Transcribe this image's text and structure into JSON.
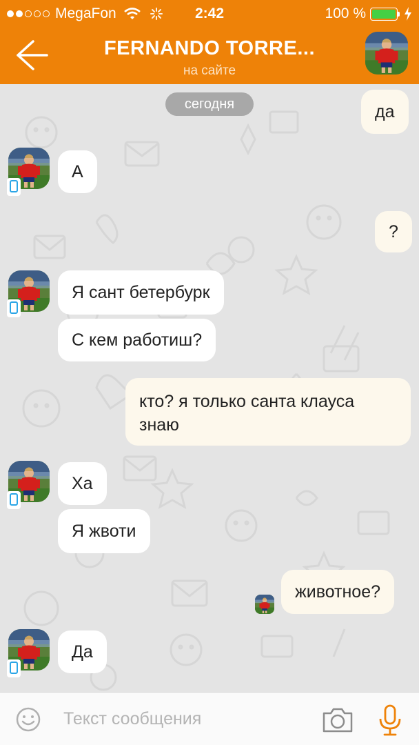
{
  "status_bar": {
    "carrier": "MegaFon",
    "time": "2:42",
    "battery": "100 %"
  },
  "header": {
    "title": "FERNANDO TORRE...",
    "subtitle": "на сайте"
  },
  "chat": {
    "date_label": "сегодня",
    "messages": [
      {
        "direction": "out",
        "text": "да"
      },
      {
        "direction": "in",
        "text": "А"
      },
      {
        "direction": "out",
        "text": "?"
      },
      {
        "direction": "in",
        "text": "Я сант бетербурк"
      },
      {
        "direction": "in",
        "text": "С кем работиш?"
      },
      {
        "direction": "out",
        "text": "кто? я только санта клауса знаю"
      },
      {
        "direction": "in",
        "text": "Ха"
      },
      {
        "direction": "in",
        "text": "Я жвоти"
      },
      {
        "direction": "out",
        "text": "животное?"
      },
      {
        "direction": "in",
        "text": "Да"
      }
    ]
  },
  "composer": {
    "placeholder": "Текст сообщения"
  },
  "colors": {
    "accent": "#ee8208",
    "incoming_bubble": "#ffffff",
    "outgoing_bubble": "#fdf8ec",
    "background": "#e4e4e4",
    "mic": "#ee8208"
  }
}
